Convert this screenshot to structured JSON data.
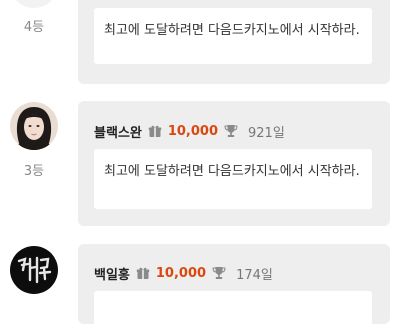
{
  "entries": [
    {
      "rank": "4등",
      "username": "",
      "points": "",
      "days": "",
      "comment": "최고에 도달하려면 다음드카지노에서 시작하라."
    },
    {
      "rank": "3등",
      "username": "블랙스완",
      "points": "10,000",
      "days": "921일",
      "comment": "최고에 도달하려면 다음드카지노에서 시작하라."
    },
    {
      "rank": "",
      "username": "백일홍",
      "points": "10,000",
      "days": "174일",
      "comment": ""
    }
  ],
  "icons": {
    "points": "gift-icon",
    "days": "trophy-icon"
  },
  "colors": {
    "points": "#d9480f",
    "card_background": "#eeeeee",
    "page_background": "#ffffff"
  }
}
